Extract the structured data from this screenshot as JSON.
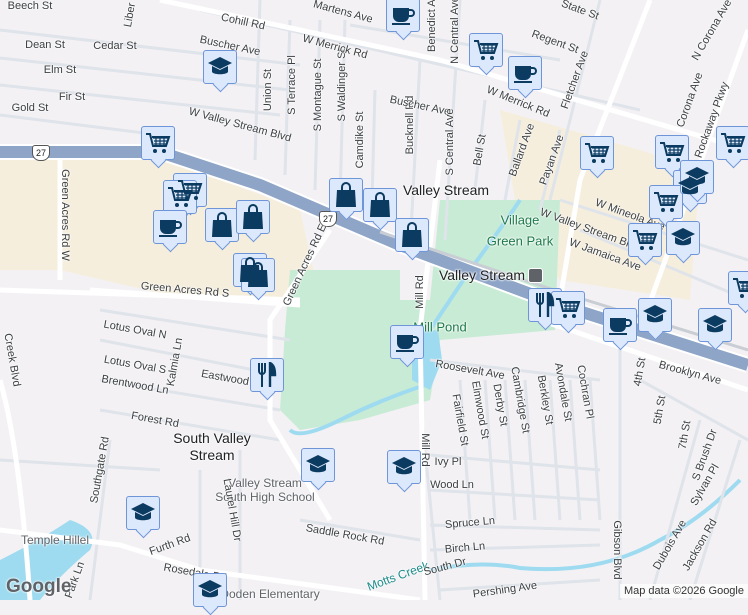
{
  "map": {
    "colors": {
      "land": "#f3f1f4",
      "road": "#ffffff",
      "minor_road": "#dfe3ea",
      "highway": "#8ea5c7",
      "park": "#c8ebd5",
      "water": "#9edbf0",
      "commercial": "#f6eedc",
      "marker_fill": "#dce8fb",
      "marker_border": "#6e95d8",
      "icon": "#0b3b60"
    },
    "place_labels": {
      "town1": "Valley Stream",
      "town2_line1": "South Valley",
      "town2_line2": "Stream",
      "park1_line1": "Village",
      "park1_line2": "Green Park",
      "pond": "Mill Pond",
      "station": "Valley Stream",
      "creek": "Motts Creek",
      "school1_line1": "Valley Stream",
      "school1_line2": "South High School",
      "temple": "Temple Hillel",
      "school2": "Doden Elementary"
    },
    "streets": [
      "Beech St",
      "Dean St",
      "Cedar St",
      "Elm St",
      "Fir St",
      "Gold St",
      "Cohill Rd",
      "Buscher Ave",
      "W Valley Stream Blvd",
      "Union St",
      "S Terrace Pl",
      "S Montague St",
      "S Waldinger St",
      "Camdike St",
      "Bucknell Rd",
      "Buscher Ave",
      "Martens Ave",
      "W Merrick Rd",
      "W Merrick Rd",
      "Benedict Ave",
      "N Central Ave",
      "S Central Ave",
      "Bell St",
      "Regent St",
      "State St",
      "Fletcher Ave",
      "Ballard Ave",
      "Payan Ave",
      "N Corona Ave",
      "Corona Ave",
      "Rockaway Pkwy",
      "W Mineola Ave",
      "W Valley Stream Blvd",
      "W Jamaica Ave",
      "Mill Rd",
      "Green Acres Rd W",
      "Green Acres Rd S",
      "Green Acres Rd E",
      "Lotus Oval N",
      "Lotus Oval S",
      "Kalmia Ln",
      "Brentwood Ln",
      "Eastwood",
      "Forest Rd",
      "Creek Blvd",
      "Roosevelt Ave",
      "Fairfield St",
      "Elmwood St",
      "Derby St",
      "Cambridge St",
      "Berkley St",
      "Avondale St",
      "Cochran Pl",
      "Mill Rd",
      "Southgate Rd",
      "Laurel Hill Dr",
      "Ivy Pl",
      "Wood Ln",
      "Spruce Ln",
      "Birch Ln",
      "Saddle Rock Rd",
      "Furth Rd",
      "Rosedale Rd",
      "Park Ln",
      "South Dr",
      "Pershing Ave",
      "Gibson Blvd",
      "Dubois Ave",
      "Jackson Rd",
      "Brooklyn Ave",
      "4th St",
      "5th St",
      "7th St",
      "S Brush Dr",
      "Sylvan Pl",
      "Liber"
    ],
    "route_shields": [
      "27",
      "27"
    ],
    "markers": [
      {
        "type": "coffee"
      },
      {
        "type": "school"
      },
      {
        "type": "cart"
      },
      {
        "type": "coffee"
      },
      {
        "type": "cart"
      },
      {
        "type": "cart"
      },
      {
        "type": "cart"
      },
      {
        "type": "cart"
      },
      {
        "type": "school"
      },
      {
        "type": "cart"
      },
      {
        "type": "cart"
      },
      {
        "type": "school"
      },
      {
        "type": "cart"
      },
      {
        "type": "cart"
      },
      {
        "type": "cart"
      },
      {
        "type": "coffee"
      },
      {
        "type": "bag"
      },
      {
        "type": "bag"
      },
      {
        "type": "bag"
      },
      {
        "type": "bag"
      },
      {
        "type": "bag"
      },
      {
        "type": "bag"
      },
      {
        "type": "bag"
      },
      {
        "type": "restaurant"
      },
      {
        "type": "cart"
      },
      {
        "type": "school"
      },
      {
        "type": "coffee"
      },
      {
        "type": "school"
      },
      {
        "type": "coffee"
      },
      {
        "type": "restaurant"
      },
      {
        "type": "school"
      },
      {
        "type": "school"
      },
      {
        "type": "school"
      },
      {
        "type": "school"
      },
      {
        "type": "school"
      }
    ],
    "logo": "Google",
    "attribution": "Map data ©2026 Google"
  }
}
